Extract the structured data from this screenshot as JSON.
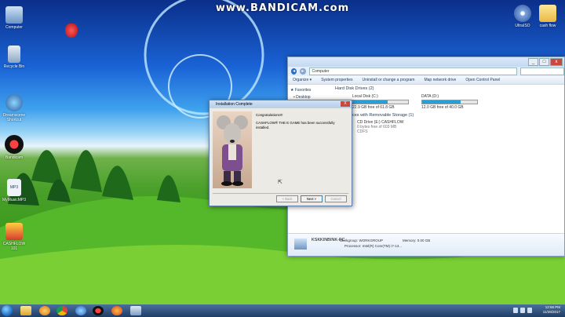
{
  "watermark": "www.BANDICAM.com",
  "desktop_icons": [
    {
      "label": "Computer"
    },
    {
      "label": "Recycle Bin"
    },
    {
      "label": "Dreamscene Shortcut"
    },
    {
      "label": "Bandicam"
    },
    {
      "label": "MyMusicMP3"
    },
    {
      "label": "CASHFLOW 101"
    },
    {
      "label": "UltraISO"
    },
    {
      "label": "cash flow"
    }
  ],
  "explorer": {
    "address": "Computer",
    "commands": [
      "Organize ▾",
      "System properties",
      "Uninstall or change a program",
      "Map network drive",
      "Open Control Panel"
    ],
    "nav": {
      "favorites": "Favorites",
      "desktop": "Desktop"
    },
    "hdd_group": "Hard Disk Drives (2)",
    "drives": [
      {
        "name": "Local Disk (C:)",
        "space": "22.9 GB free of 61.8 GB",
        "used": 0.63
      },
      {
        "name": "DATA (D:)",
        "space": "12.0 GB free of 40.0 GB",
        "used": 0.7
      }
    ],
    "removable_group": "ces with Removable Storage (1)",
    "cd": {
      "name": "CD Drive (E:) CASHFLOW",
      "space": "0 bytes free of 603 MB",
      "fs": "CDFS"
    },
    "details": {
      "computer": "KSKKINBINK-PC",
      "workgroup_label": "Workgroup:",
      "workgroup": "WORKGROUP",
      "memory_label": "Memory:",
      "memory": "0.00 GB",
      "processor_label": "Processor:",
      "processor": "Intel(R) Core(TM) i7-13..."
    }
  },
  "dialog": {
    "title": "Installation Complete",
    "close": "X",
    "line1": "Congratulations!!!",
    "line2": "CASHFLOW® THE E GAME has been successfully installed.",
    "buttons": {
      "back": "< Back",
      "next": "Next >",
      "cancel": "Cancel"
    }
  },
  "taskbar": {
    "time": "12:56 PM",
    "date": "11/28/2017"
  }
}
